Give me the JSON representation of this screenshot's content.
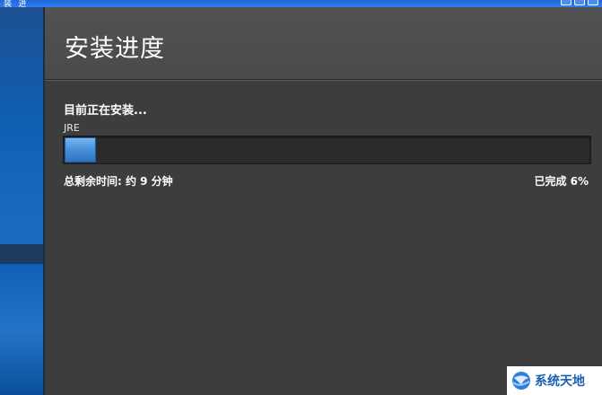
{
  "window": {
    "title_fragment": "装 进"
  },
  "header": {
    "title": "安装进度"
  },
  "install": {
    "status": "目前正在安装...",
    "component": "JRE",
    "time_remaining": "总剩余时间: 约 9 分钟",
    "percent_label": "已完成 6%",
    "progress_percent": 6
  },
  "watermark": {
    "text": "系统天地",
    "icon": "globe-logo-icon"
  },
  "colors": {
    "background": "#3d3d3d",
    "header": "#4e4e4e",
    "progress_fill": "#4a92db",
    "progress_track": "#2b2b2b",
    "sidebar_blue": "#1565c0"
  }
}
